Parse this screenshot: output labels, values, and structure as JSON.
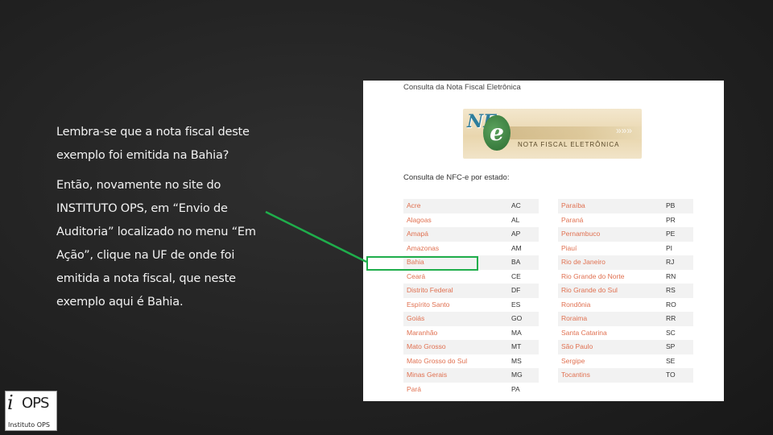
{
  "slide": {
    "paragraph1": "Lembra-se que a nota fiscal deste exemplo foi emitida na Bahia?",
    "paragraph2": "Então, novamente no site do INSTITUTO OPS, em “Envio de Auditoria” localizado no menu “Em Ação”,  clique na UF de onde foi emitida a nota fiscal, que neste exemplo aqui é Bahia."
  },
  "panel": {
    "title": "Consulta da Nota Fiscal Eletrônica",
    "banner_logo": "NF",
    "banner_e": "e",
    "banner_caption": "NOTA FISCAL ELETRÔNICA",
    "subtitle": "Consulta de NFC-e por estado:",
    "left_states": [
      {
        "name": "Acre",
        "uf": "AC"
      },
      {
        "name": "Alagoas",
        "uf": "AL"
      },
      {
        "name": "Amapá",
        "uf": "AP"
      },
      {
        "name": "Amazonas",
        "uf": "AM"
      },
      {
        "name": "Bahia",
        "uf": "BA"
      },
      {
        "name": "Ceará",
        "uf": "CE"
      },
      {
        "name": "Distrito Federal",
        "uf": "DF"
      },
      {
        "name": "Espírito Santo",
        "uf": "ES"
      },
      {
        "name": "Goiás",
        "uf": "GO"
      },
      {
        "name": "Maranhão",
        "uf": "MA"
      },
      {
        "name": "Mato Grosso",
        "uf": "MT"
      },
      {
        "name": "Mato Grosso do Sul",
        "uf": "MS"
      },
      {
        "name": "Minas Gerais",
        "uf": "MG"
      },
      {
        "name": "Pará",
        "uf": "PA"
      }
    ],
    "right_states": [
      {
        "name": "Paraíba",
        "uf": "PB"
      },
      {
        "name": "Paraná",
        "uf": "PR"
      },
      {
        "name": "Pernambuco",
        "uf": "PE"
      },
      {
        "name": "Piauí",
        "uf": "PI"
      },
      {
        "name": "Rio de Janeiro",
        "uf": "RJ"
      },
      {
        "name": "Rio Grande do Norte",
        "uf": "RN"
      },
      {
        "name": "Rio Grande do Sul",
        "uf": "RS"
      },
      {
        "name": "Rondônia",
        "uf": "RO"
      },
      {
        "name": "Roraima",
        "uf": "RR"
      },
      {
        "name": "Santa Catarina",
        "uf": "SC"
      },
      {
        "name": "São Paulo",
        "uf": "SP"
      },
      {
        "name": "Sergipe",
        "uf": "SE"
      },
      {
        "name": "Tocantins",
        "uf": "TO"
      }
    ]
  },
  "logo": {
    "mark": "i",
    "name": "OPS",
    "caption": "Instituto OPS"
  },
  "colors": {
    "highlight": "#1fae4b",
    "link": "#e07050"
  }
}
